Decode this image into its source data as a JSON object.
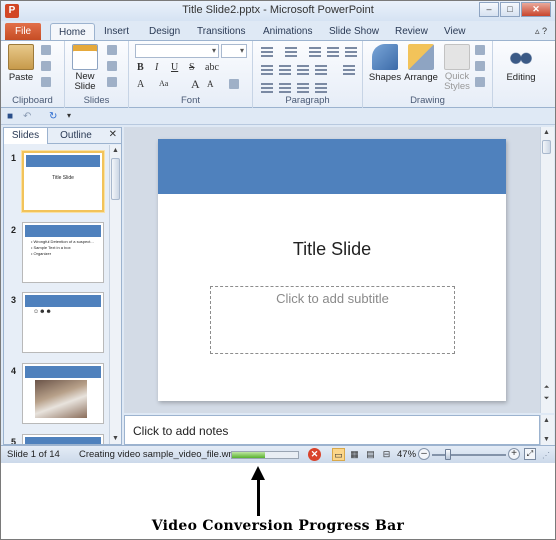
{
  "window": {
    "title": "Title Slide2.pptx - Microsoft PowerPoint",
    "app_icon": "P"
  },
  "ribbon_tabs": [
    "File",
    "Home",
    "Insert",
    "Design",
    "Transitions",
    "Animations",
    "Slide Show",
    "Review",
    "View"
  ],
  "ribbon": {
    "clipboard": {
      "paste": "Paste",
      "label": "Clipboard"
    },
    "slides": {
      "new_slide": "New Slide",
      "label": "Slides"
    },
    "font": {
      "label": "Font",
      "bold": "B",
      "italic": "I",
      "underline": "U",
      "strike": "S",
      "abc": "abc",
      "grow": "A",
      "shrink": "A"
    },
    "paragraph": {
      "label": "Paragraph"
    },
    "drawing": {
      "shapes": "Shapes",
      "arrange": "Arrange",
      "quick_styles": "Quick Styles",
      "label": "Drawing"
    },
    "editing": {
      "label": "Editing"
    }
  },
  "left_pane": {
    "tabs": [
      "Slides",
      "Outline"
    ],
    "close": "✕",
    "thumbnails": [
      {
        "num": "1",
        "title": "Title Slide",
        "kind": "title"
      },
      {
        "num": "2",
        "kind": "bullets",
        "lines": [
          "• Wrongful Detention of a suspect...",
          "• Sample Text in a box",
          "• Organizer"
        ]
      },
      {
        "num": "3",
        "kind": "icons",
        "text": "☺☻☻"
      },
      {
        "num": "4",
        "kind": "photo"
      },
      {
        "num": "5",
        "kind": "blank"
      }
    ]
  },
  "slide": {
    "title": "Title Slide",
    "subtitle_placeholder": "Click to add subtitle"
  },
  "notes": {
    "placeholder": "Click to add notes"
  },
  "status": {
    "slide_counter": "Slide 1 of 14",
    "task": "Creating video sample_video_file.wmv",
    "progress_fraction": 0.5,
    "zoom": "47%",
    "zoom_fraction": 0.22
  },
  "annotation": {
    "caption": "Video Conversion Progress Bar"
  },
  "colors": {
    "accent": "#4f81bd",
    "file_tab": "#c44a22",
    "progress": "#58b22f"
  }
}
